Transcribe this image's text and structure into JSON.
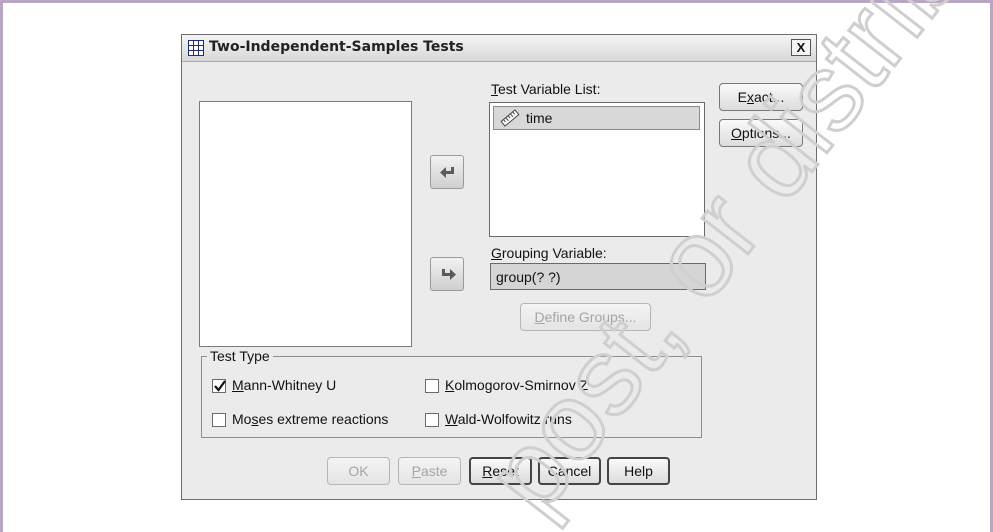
{
  "dialog": {
    "title": "Two-Independent-Samples Tests",
    "close_label": "X"
  },
  "test_variable_list": {
    "label_mnemonic": "T",
    "label_rest": "est Variable List:",
    "items": [
      {
        "label": "time",
        "icon": "scale-ruler-icon"
      }
    ]
  },
  "grouping_variable": {
    "label_mnemonic": "G",
    "label_rest": "rouping Variable:",
    "value": "group(? ?)"
  },
  "buttons": {
    "exact": {
      "pre": "E",
      "mnemonic": "x",
      "post": "act..."
    },
    "options": {
      "pre": "",
      "mnemonic": "O",
      "post": "ptions..."
    },
    "define_groups": {
      "pre": "",
      "mnemonic": "D",
      "post": "efine Groups..."
    },
    "ok": "OK",
    "paste": {
      "pre": "",
      "mnemonic": "P",
      "post": "aste"
    },
    "reset": {
      "pre": "",
      "mnemonic": "R",
      "post": "eset"
    },
    "cancel": "Cancel",
    "help": "Help"
  },
  "test_type": {
    "legend": "Test Type",
    "options": [
      {
        "pre": "",
        "mnemonic": "M",
        "post": "ann-Whitney U",
        "checked": true
      },
      {
        "pre": "",
        "mnemonic": "K",
        "post": "olmogorov-Smirnov Z",
        "checked": false
      },
      {
        "pre": "Mo",
        "mnemonic": "s",
        "post": "es extreme reactions",
        "checked": false
      },
      {
        "pre": "",
        "mnemonic": "W",
        "post": "ald-Wolfowitz runs",
        "checked": false
      }
    ]
  },
  "watermark": "post, or distribute",
  "colors": {
    "dialog_bg": "#ebebeb",
    "frame": "#b7a6c4",
    "selected_item": "#d8d8d8"
  }
}
